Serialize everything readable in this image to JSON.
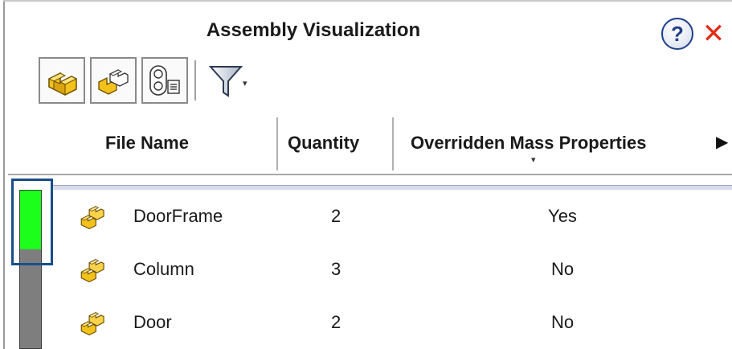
{
  "window": {
    "title": "Assembly Visualization",
    "help_label": "?",
    "close_label": "✕"
  },
  "toolbar": {
    "buttons": [
      {
        "icon": "part-icon"
      },
      {
        "icon": "assembly-icon"
      },
      {
        "icon": "display-list-icon"
      }
    ],
    "filter_icon": "filter-icon",
    "filter_caret": "▾"
  },
  "table": {
    "columns": [
      "File Name",
      "Quantity",
      "Overridden Mass Properties"
    ],
    "sort_indicator": "▾",
    "scroll_right": "▶",
    "rows": [
      {
        "icon": "assembly-icon",
        "name": "DoorFrame",
        "quantity": "2",
        "overridden": "Yes"
      },
      {
        "icon": "assembly-icon",
        "name": "Column",
        "quantity": "3",
        "overridden": "No"
      },
      {
        "icon": "assembly-icon",
        "name": "Door",
        "quantity": "2",
        "overridden": "No"
      }
    ]
  },
  "value_bar": {
    "fill_fraction": 0.37,
    "fill_color": "#1bff1b",
    "track_color": "#7e7e7e",
    "highlight_color": "#1a4e8a"
  },
  "colors": {
    "close": "#e32b16",
    "help": "#1f3f8a",
    "icon_yellow": "#f2c21b"
  }
}
